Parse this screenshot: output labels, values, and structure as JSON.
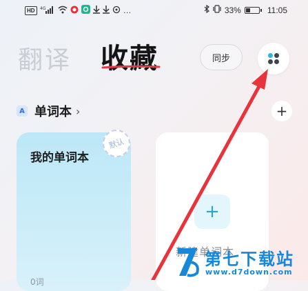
{
  "status_bar": {
    "network_badge": "HD",
    "signal_type": "4G",
    "battery_percent": "33%",
    "battery_level": 0.33,
    "time": "11:05"
  },
  "tabs": {
    "translate": "翻译",
    "favorites": "收藏"
  },
  "header": {
    "sync_label": "同步",
    "menu_icon": "four-dots-icon"
  },
  "section": {
    "badge": "A",
    "title": "单词本",
    "chevron": "›",
    "add_icon": "+"
  },
  "cards": {
    "mine": {
      "title": "我的单词本",
      "stamp": "默认",
      "count": "0词"
    },
    "new": {
      "plus": "+",
      "label": "新建单词本"
    }
  },
  "watermark": {
    "name": "第七下载站",
    "url": "www.d7down.com"
  },
  "colors": {
    "accent_red": "#e8323c",
    "tab_underline": "#e23a4a",
    "watermark_blue": "#1687d9",
    "card_blue": "#c8ecf8"
  }
}
